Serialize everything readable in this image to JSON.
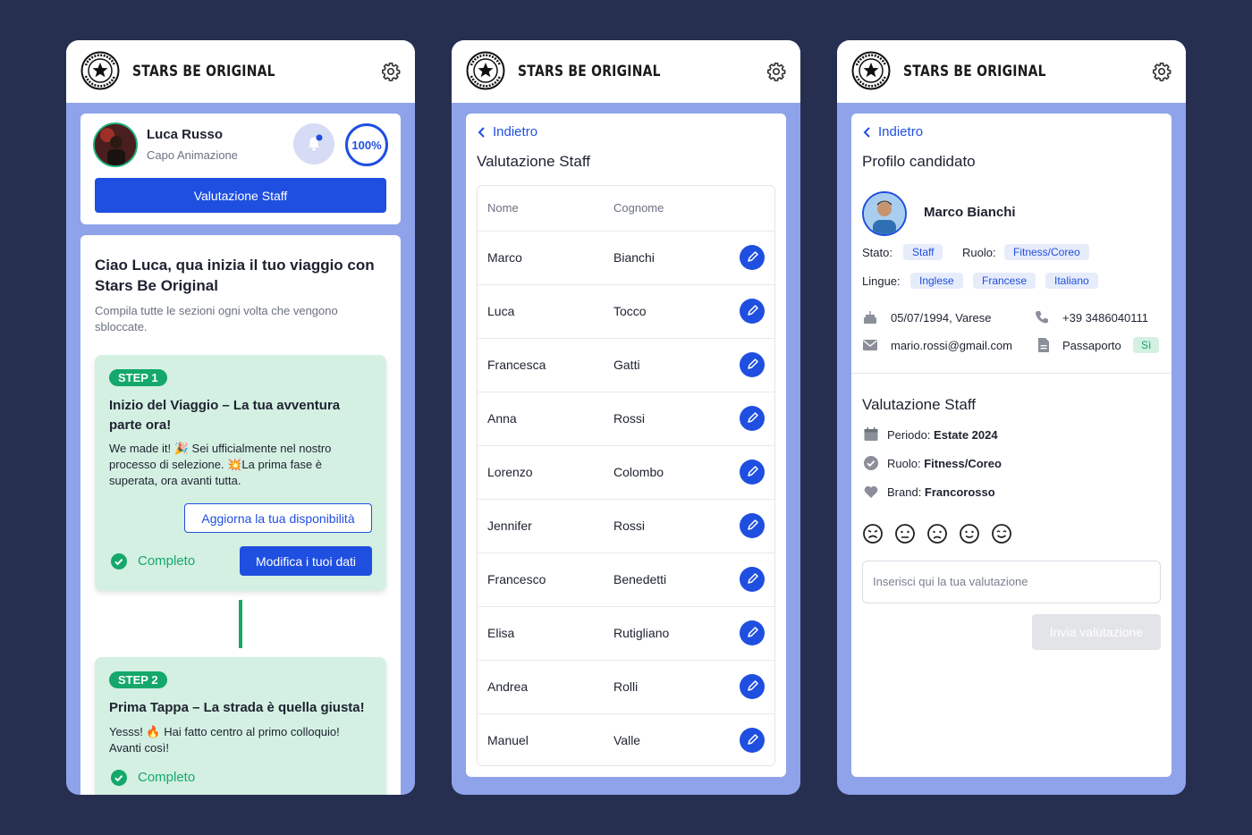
{
  "brand": "STARS BE ORIGINAL",
  "screen1": {
    "user_name": "Luca Russo",
    "user_role": "Capo Animazione",
    "progress": "100%",
    "staff_button": "Valutazione Staff",
    "welcome_title_1": "Ciao Luca, qua inizia il tuo viaggio con",
    "welcome_title_2": "Stars Be Original",
    "welcome_sub_1": "Compila tutte le sezioni ogni volta che vengono",
    "welcome_sub_2": "sbloccate.",
    "step1": {
      "badge": "STEP 1",
      "title_1": "Inizio del Viaggio – La tua avventura",
      "title_2": "parte ora!",
      "text_1": "We made it! 🎉 Sei ufficialmente nel nostro",
      "text_2": "processo di selezione. 💥La prima fase è",
      "text_3": "superata, ora avanti tutta.",
      "availability_button": "Aggiorna la tua disponibilità",
      "status": "Completo",
      "edit_button": "Modifica i tuoi dati"
    },
    "step2": {
      "badge": "STEP 2",
      "title": "Prima Tappa – La strada è quella giusta!",
      "text_1": "Yesss! 🔥 Hai fatto centro al primo colloquio!",
      "text_2": "Avanti così!",
      "status": "Completo"
    }
  },
  "screen2": {
    "back": "Indietro",
    "title": "Valutazione Staff",
    "col_name": "Nome",
    "col_surname": "Cognome",
    "rows": [
      {
        "name": "Marco",
        "surname": "Bianchi"
      },
      {
        "name": "Luca",
        "surname": "Tocco"
      },
      {
        "name": "Francesca",
        "surname": "Gatti"
      },
      {
        "name": "Anna",
        "surname": "Rossi"
      },
      {
        "name": "Lorenzo",
        "surname": "Colombo"
      },
      {
        "name": "Jennifer",
        "surname": "Rossi"
      },
      {
        "name": "Francesco",
        "surname": "Benedetti"
      },
      {
        "name": "Elisa",
        "surname": "Rutigliano"
      },
      {
        "name": "Andrea",
        "surname": "Rolli"
      },
      {
        "name": "Manuel",
        "surname": "Valle"
      }
    ]
  },
  "screen3": {
    "back": "Indietro",
    "title": "Profilo candidato",
    "name": "Marco Bianchi",
    "stato_label": "Stato:",
    "stato_value": "Staff",
    "ruolo_label": "Ruolo:",
    "ruolo_value": "Fitness/Coreo",
    "lingue_label": "Lingue:",
    "lingue": [
      "Inglese",
      "Francese",
      "Italiano"
    ],
    "birth": "05/07/1994, Varese",
    "phone": "+39 3486040111",
    "email": "mario.rossi@gmail.com",
    "passport_label": "Passaporto",
    "passport_value": "Sì",
    "eval_title": "Valutazione Staff",
    "periodo_label": "Periodo: ",
    "periodo_value": "Estate 2024",
    "ruolo2_label": "Ruolo: ",
    "ruolo2_value": "Fitness/Coreo",
    "brand_label": "Brand: ",
    "brand_value": "Francorosso",
    "input_placeholder": "Inserisci qui la tua valutazione",
    "submit": "Invia valutazione"
  },
  "colors": {
    "background": "#272f50",
    "phone_frame": "#8fa3ea",
    "primary": "#1f4fe0",
    "success": "#14a86b",
    "step_bg": "#d4f0e2"
  }
}
